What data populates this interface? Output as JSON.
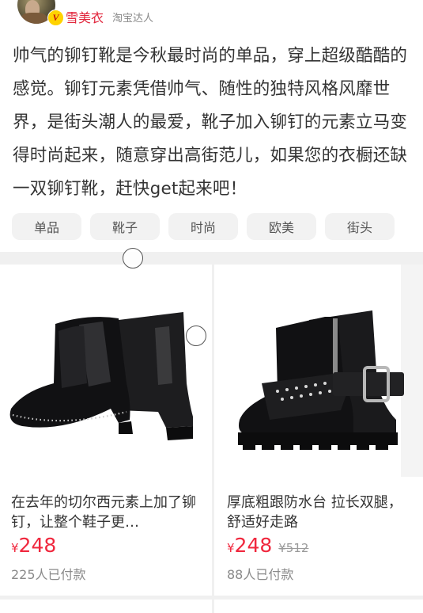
{
  "author": {
    "name": "雪美衣",
    "tag": "淘宝达人",
    "badge": "V"
  },
  "description": "帅气的铆钉靴是今秋最时尚的单品，穿上超级酷酷的感觉。铆钉元素凭借帅气、随性的独特风格风靡世界，是街头潮人的最爱，靴子加入铆钉的元素立马变得时尚起来，随意穿出高街范儿，如果您的衣橱还缺一双铆钉靴，赶快get起来吧！",
  "tags": [
    "单品",
    "靴子",
    "时尚",
    "欧美",
    "街头"
  ],
  "products": [
    {
      "title": "在去年的切尔西元素上加了铆钉，让整个鞋子更…",
      "currency": "¥",
      "price": "248",
      "old_price": "",
      "sold": "225人已付款",
      "image_icon": "chelsea-boot-icon"
    },
    {
      "title": "厚底粗跟防水台 拉长双腿，舒适好走路",
      "currency": "¥",
      "price": "248",
      "old_price": "¥512",
      "sold": "88人已付款",
      "image_icon": "buckle-boot-icon"
    }
  ],
  "colors": {
    "accent": "#f0283e",
    "username": "#e1253b",
    "tag_bg": "#f2f2f2",
    "muted": "#8a8a8a"
  }
}
